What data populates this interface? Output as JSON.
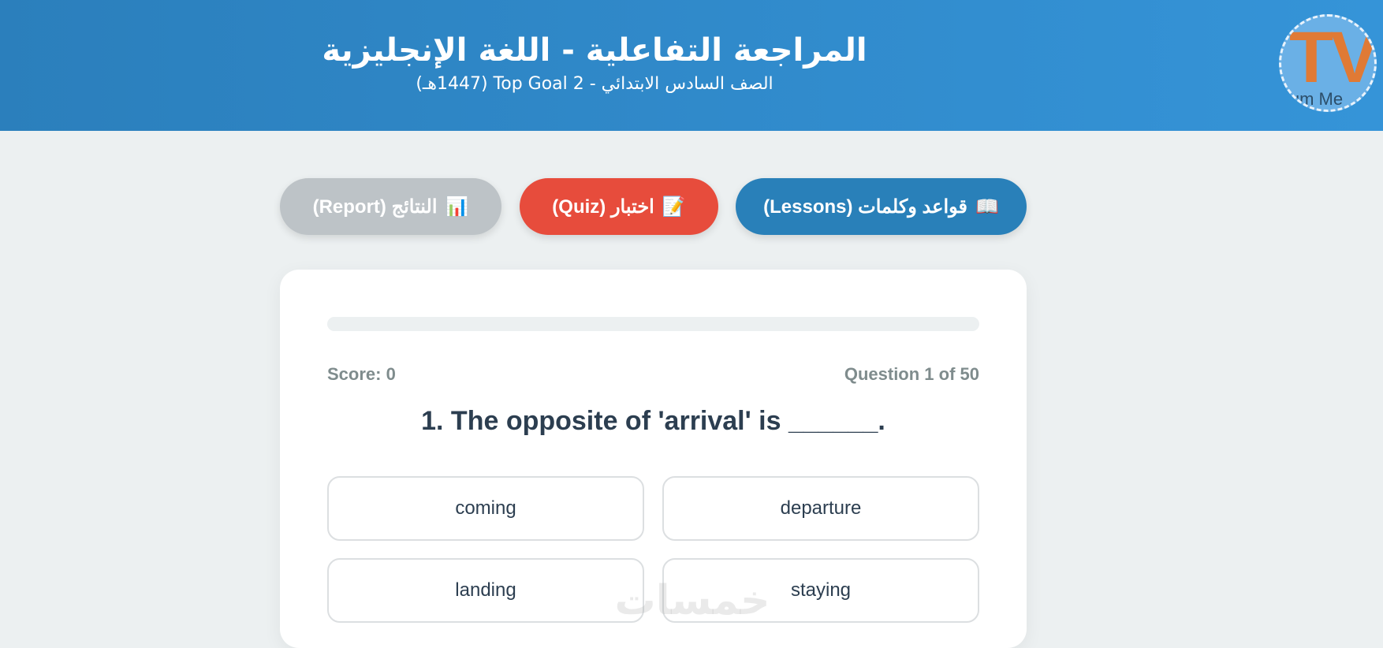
{
  "header": {
    "title": "المراجعة التفاعلية - اللغة الإنجليزية",
    "subtitle": "الصف السادس الابتدائي - Top Goal 2 (1447هـ)",
    "logo": {
      "letters": "TV",
      "caption": "ium Me"
    }
  },
  "nav": {
    "report": {
      "icon": "📊",
      "label": "النتائج (Report)",
      "color": "#bdc3c7"
    },
    "quiz": {
      "icon": "📝",
      "label": "اختبار (Quiz)",
      "color": "#e74c3c"
    },
    "lessons": {
      "icon": "📖",
      "label": "قواعد وكلمات (Lessons)",
      "color": "#2980b9"
    }
  },
  "quiz": {
    "progress": 0,
    "score_label": "Score: 0",
    "question_counter": "Question 1 of 50",
    "question": "1. The opposite of 'arrival' is ______.",
    "options": [
      "coming",
      "departure",
      "landing",
      "staying"
    ]
  },
  "watermark": "خمسات",
  "colors": {
    "header_start": "#2b7fbc",
    "header_end": "#3594d8",
    "background": "#ecf0f1",
    "text_dark": "#2c3e50",
    "text_muted": "#7f8c8d"
  }
}
